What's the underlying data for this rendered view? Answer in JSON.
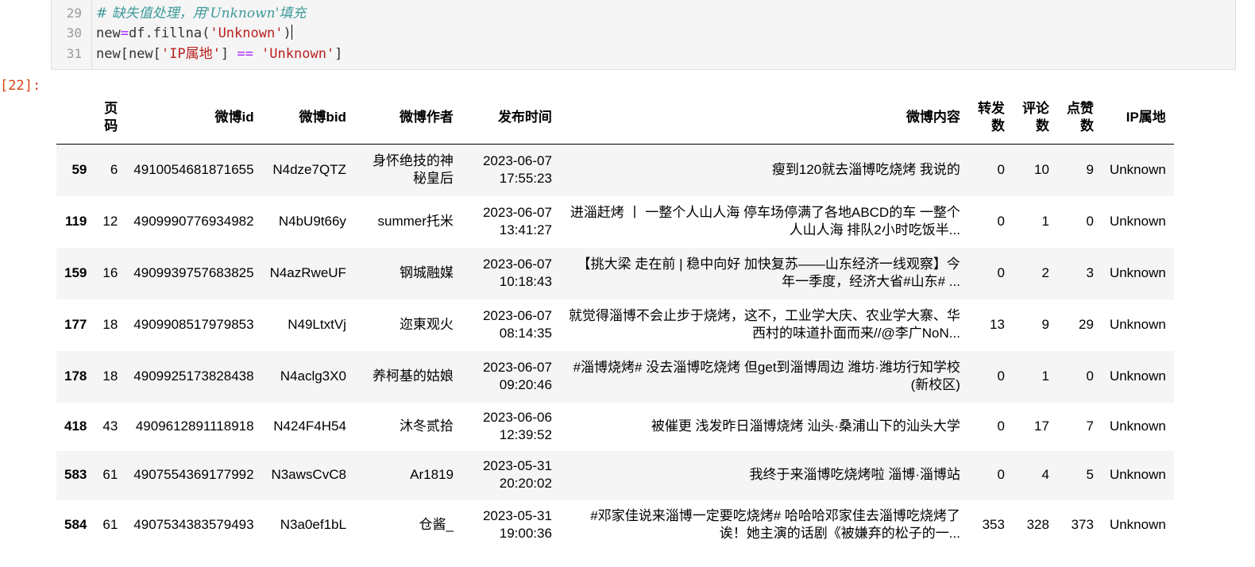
{
  "code": {
    "lines": [
      {
        "num": "29",
        "comment": "# 缺失值处理，用'Unknown'填充"
      },
      {
        "num": "30",
        "pre": "new",
        "op": "=",
        "mid": "df.fillna(",
        "str": "'Unknown'",
        "post": ")"
      },
      {
        "num": "31",
        "pre": "new[new[",
        "str": "'IP属地'",
        "mid": "] ",
        "op": "==",
        "str2": " 'Unknown'",
        "post": "]"
      }
    ]
  },
  "output": {
    "prompt": "[22]:"
  },
  "table": {
    "columns": [
      "",
      "页码",
      "微博id",
      "微博bid",
      "微博作者",
      "发布时间",
      "微博内容",
      "转发数",
      "评论数",
      "点赞数",
      "IP属地"
    ],
    "rows": [
      {
        "index": "59",
        "page": "6",
        "id": "4910054681871655",
        "bid": "N4dze7QTZ",
        "author": "身怀绝技的神秘皇后",
        "time": "2023-06-07 17:55:23",
        "content": "瘦到120就去淄博吃烧烤 我说的",
        "reposts": "0",
        "comments": "10",
        "likes": "9",
        "ip": "Unknown"
      },
      {
        "index": "119",
        "page": "12",
        "id": "4909990776934982",
        "bid": "N4bU9t66y",
        "author": "summer托米",
        "time": "2023-06-07 13:41:27",
        "content": "进淄赶烤 丨 一整个人山人海 停车场停满了各地ABCD的车 一整个人山人海 排队2小时吃饭半...",
        "reposts": "0",
        "comments": "1",
        "likes": "0",
        "ip": "Unknown"
      },
      {
        "index": "159",
        "page": "16",
        "id": "4909939757683825",
        "bid": "N4azRweUF",
        "author": "钢城融媒",
        "time": "2023-06-07 10:18:43",
        "content": "【挑大梁 走在前 | 稳中向好 加快复苏——山东经济一线观察】今年一季度，经济大省#山东# ...",
        "reposts": "0",
        "comments": "2",
        "likes": "3",
        "ip": "Unknown"
      },
      {
        "index": "177",
        "page": "18",
        "id": "4909908517979853",
        "bid": "N49LtxtVj",
        "author": "迩東观火",
        "time": "2023-06-07 08:14:35",
        "content": "就觉得淄博不会止步于烧烤，这不，工业学大庆、农业学大寨、华西村的味道扑面而来//@李广NoN...",
        "reposts": "13",
        "comments": "9",
        "likes": "29",
        "ip": "Unknown"
      },
      {
        "index": "178",
        "page": "18",
        "id": "4909925173828438",
        "bid": "N4aclg3X0",
        "author": "养柯基的姑娘",
        "time": "2023-06-07 09:20:46",
        "content": "#淄博烧烤# 没去淄博吃烧烤 但get到淄博周边 潍坊·潍坊行知学校(新校区)",
        "reposts": "0",
        "comments": "1",
        "likes": "0",
        "ip": "Unknown"
      },
      {
        "index": "418",
        "page": "43",
        "id": "4909612891118918",
        "bid": "N424F4H54",
        "author": "沐冬贰拾",
        "time": "2023-06-06 12:39:52",
        "content": "被催更 浅发昨日淄博烧烤 汕头·桑浦山下的汕头大学",
        "reposts": "0",
        "comments": "17",
        "likes": "7",
        "ip": "Unknown"
      },
      {
        "index": "583",
        "page": "61",
        "id": "4907554369177992",
        "bid": "N3awsCvC8",
        "author": "Ar1819",
        "time": "2023-05-31 20:20:02",
        "content": "我终于来淄博吃烧烤啦 淄博·淄博站",
        "reposts": "0",
        "comments": "4",
        "likes": "5",
        "ip": "Unknown"
      },
      {
        "index": "584",
        "page": "61",
        "id": "4907534383579493",
        "bid": "N3a0ef1bL",
        "author": "仓酱_",
        "time": "2023-05-31 19:00:36",
        "content": "#邓家佳说来淄博一定要吃烧烤# 哈哈哈邓家佳去淄博吃烧烤了诶！她主演的话剧《被嫌弃的松子的一...",
        "reposts": "353",
        "comments": "328",
        "likes": "373",
        "ip": "Unknown"
      }
    ]
  }
}
